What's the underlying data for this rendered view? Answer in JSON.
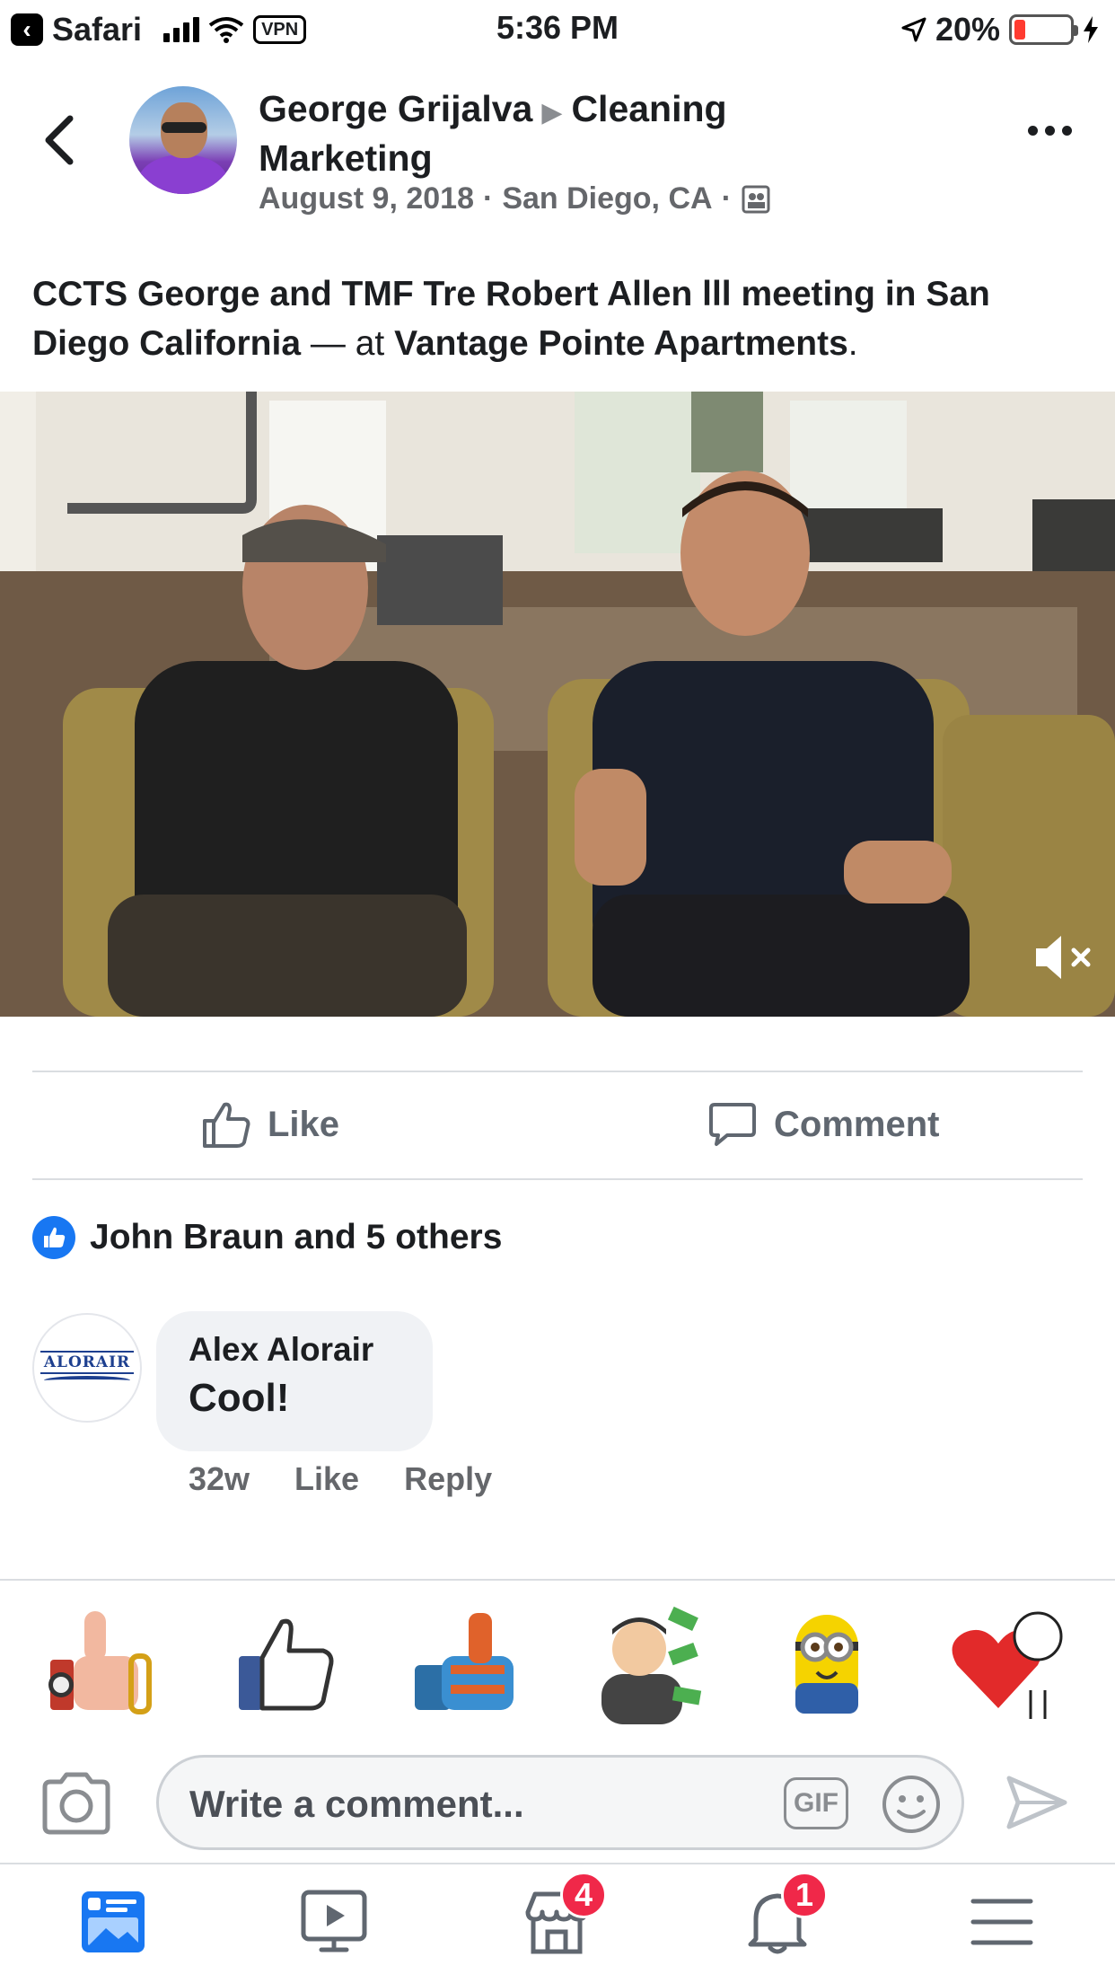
{
  "status_bar": {
    "back_app": "Safari",
    "vpn": "VPN",
    "time": "5:36 PM",
    "battery": "20%"
  },
  "post": {
    "author": "George Grijalva",
    "target": "Cleaning Marketing",
    "date": "August 9, 2018",
    "location": "San Diego, CA",
    "text_main": "CCTS George and TMF Tre Robert Allen lll meeting in San Diego California",
    "text_at": " — at ",
    "place": "Vantage Pointe Apartments",
    "text_end": "."
  },
  "actions": {
    "like": "Like",
    "comment": "Comment"
  },
  "reactions": {
    "summary": "John Braun and 5 others"
  },
  "comment": {
    "avatar_brand": "ALORAIR",
    "author": "Alex Alorair",
    "text": "Cool!",
    "age": "32w",
    "like": "Like",
    "reply": "Reply"
  },
  "composer": {
    "placeholder": "Write a comment...",
    "gif": "GIF"
  },
  "bottom_nav": {
    "marketplace_badge": "4",
    "notifications_badge": "1"
  },
  "colors": {
    "accent": "#1877f2",
    "badge": "#f02849",
    "secondary_text": "#65676b"
  }
}
